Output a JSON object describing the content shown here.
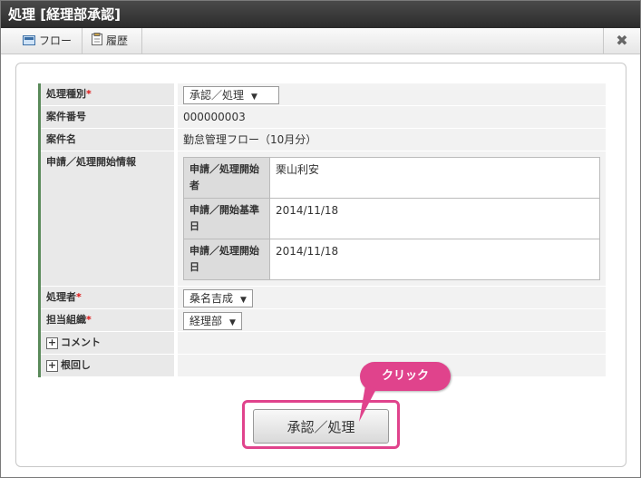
{
  "title": "処理 [経理部承認]",
  "toolbar": {
    "flow": "フロー",
    "history": "履歴"
  },
  "form": {
    "process_type_label": "処理種別",
    "process_type_value": "承認／処理",
    "case_no_label": "案件番号",
    "case_no_value": "000000003",
    "case_name_label": "案件名",
    "case_name_value": "勤怠管理フロー（10月分）",
    "start_info_label": "申請／処理開始情報",
    "start_info": [
      {
        "label": "申請／処理開始者",
        "value": "栗山利安"
      },
      {
        "label": "申請／開始基準日",
        "value": "2014/11/18"
      },
      {
        "label": "申請／処理開始日",
        "value": "2014/11/18"
      }
    ],
    "processor_label": "処理者",
    "processor_value": "桑名吉成",
    "org_label": "担当組織",
    "org_value": "経理部",
    "comment_label": "コメント",
    "nemawashi_label": "根回し",
    "required_mark": "*"
  },
  "submit_label": "承認／処理",
  "callout_label": "クリック",
  "colors": {
    "accent": "#e0438c",
    "titlebar": "#333333"
  }
}
